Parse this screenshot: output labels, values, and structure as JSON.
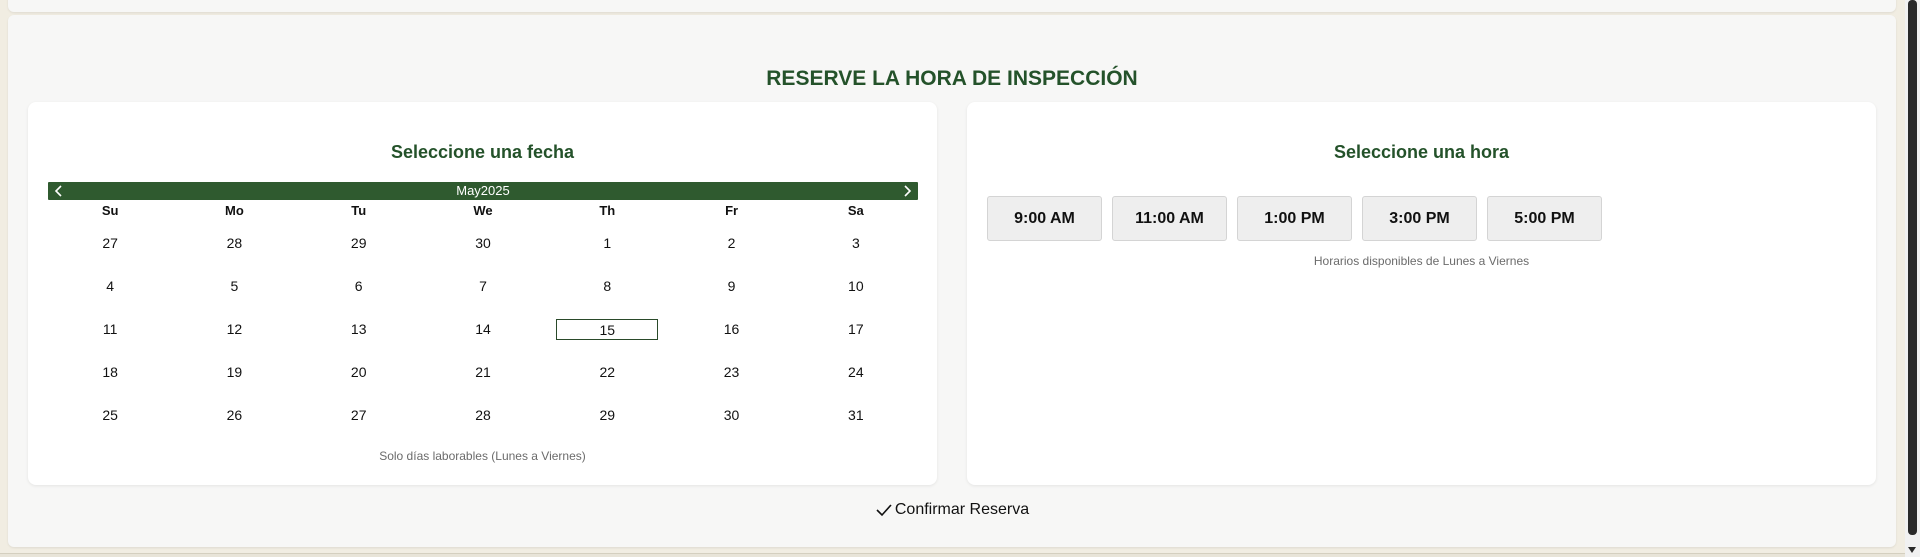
{
  "section": {
    "title": "RESERVE LA HORA DE INSPECCIÓN"
  },
  "calendar": {
    "heading": "Seleccione una fecha",
    "month_label": "May2025",
    "prev_icon": "chevron-left-icon",
    "next_icon": "chevron-right-icon",
    "weekdays": [
      "Su",
      "Mo",
      "Tu",
      "We",
      "Th",
      "Fr",
      "Sa"
    ],
    "days": [
      "27",
      "28",
      "29",
      "30",
      "1",
      "2",
      "3",
      "4",
      "5",
      "6",
      "7",
      "8",
      "9",
      "10",
      "11",
      "12",
      "13",
      "14",
      "15",
      "16",
      "17",
      "18",
      "19",
      "20",
      "21",
      "22",
      "23",
      "24",
      "25",
      "26",
      "27",
      "28",
      "29",
      "30",
      "31"
    ],
    "today_value": "15",
    "note": "Solo días laborables (Lunes a Viernes)"
  },
  "time": {
    "heading": "Seleccione una hora",
    "slots": [
      "9:00 AM",
      "11:00 AM",
      "1:00 PM",
      "3:00 PM",
      "5:00 PM"
    ],
    "note": "Horarios disponibles de Lunes a Viernes"
  },
  "confirm": {
    "icon": "check-icon",
    "label": "Confirmar Reserva"
  },
  "colors": {
    "accent": "#24522a",
    "calendar_header": "#2f5a2f",
    "page_background": "#f1ede2"
  }
}
